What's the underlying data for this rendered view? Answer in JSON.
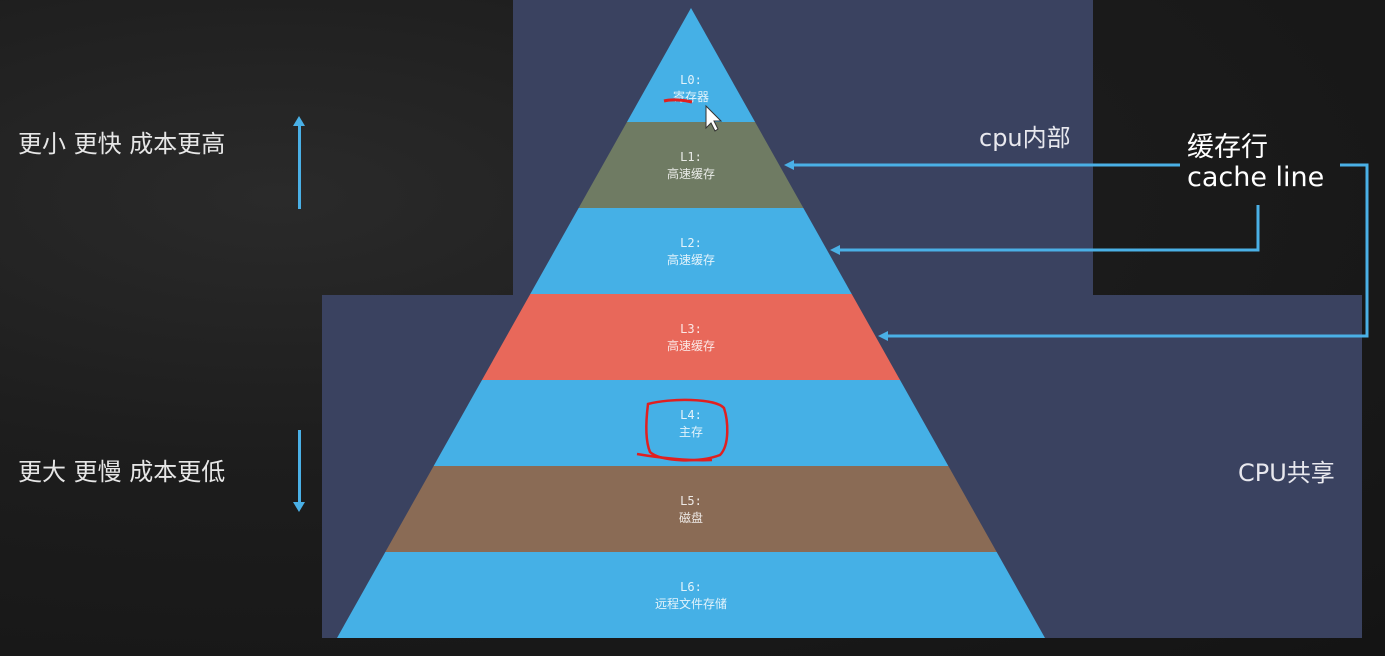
{
  "left_labels": {
    "top": "更小 更快 成本更高",
    "bottom": "更大 更慢 成本更低"
  },
  "panels": {
    "cpu_internal": "cpu内部",
    "cpu_shared": "CPU共享"
  },
  "cache_line": {
    "line1": "缓存行",
    "line2": "cache line"
  },
  "tiers": [
    {
      "level": "L0:",
      "name": "寄存器",
      "color": "#45b0e6"
    },
    {
      "level": "L1:",
      "name": "高速缓存",
      "color": "#6f7b63"
    },
    {
      "level": "L2:",
      "name": "高速缓存",
      "color": "#45b0e6"
    },
    {
      "level": "L3:",
      "name": "高速缓存",
      "color": "#e8685a"
    },
    {
      "level": "L4:",
      "name": "主存",
      "color": "#45b0e6"
    },
    {
      "level": "L5:",
      "name": "磁盘",
      "color": "#8a6b55"
    },
    {
      "level": "L6:",
      "name": "远程文件存储",
      "color": "#45b0e6"
    }
  ],
  "colors": {
    "panel": "#3a4260",
    "arrow": "#4ab0e6",
    "annotation": "#e02020"
  }
}
